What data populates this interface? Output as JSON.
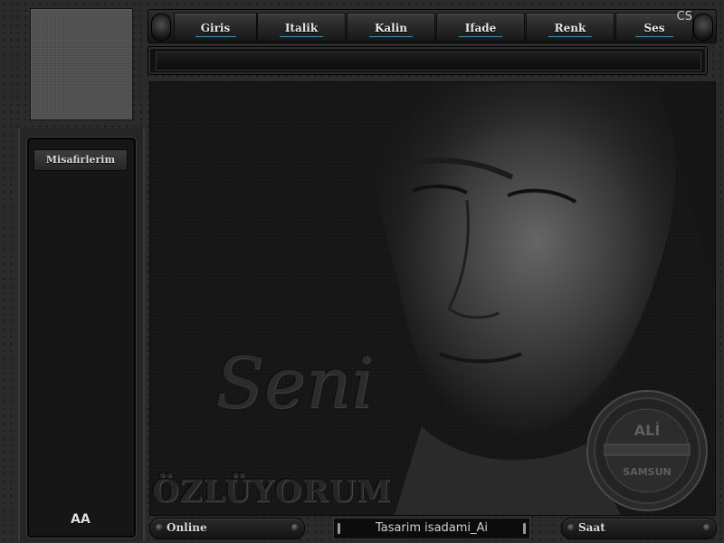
{
  "nav": {
    "items": [
      {
        "label": "Giris"
      },
      {
        "label": "Italik"
      },
      {
        "label": "Kalin"
      },
      {
        "label": "Ifade"
      },
      {
        "label": "Renk"
      },
      {
        "label": "Ses"
      }
    ],
    "corner_mark": "CS"
  },
  "sidebar": {
    "title": "Misafirlerim",
    "logo_text": "AA"
  },
  "artwork": {
    "script_text": "Seni",
    "caption": "ÖZLÜYORUM",
    "seal_top": "ALİ",
    "seal_bottom": "SAMSUN"
  },
  "footer": {
    "online_label": "Online",
    "credit": "Tasarim isadami_Ai",
    "clock_label": "Saat"
  },
  "colors": {
    "accent_underline": "#3c8fb0",
    "background": "#2b2b2b"
  },
  "icons": [
    "knob-left-icon",
    "knob-right-icon",
    "screw-icon",
    "seal-icon"
  ]
}
